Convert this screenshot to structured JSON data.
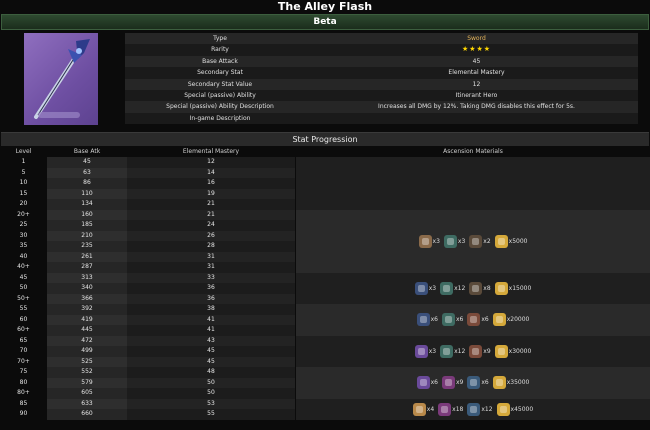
{
  "page": {
    "title": "The Alley Flash",
    "section": "Beta"
  },
  "info": [
    {
      "key": "Type",
      "value": "Sword",
      "cls": "type"
    },
    {
      "key": "Rarity",
      "value": "★★★★",
      "cls": "stars"
    },
    {
      "key": "Base Attack",
      "value": "45",
      "cls": ""
    },
    {
      "key": "Secondary Stat",
      "value": "Elemental Mastery",
      "cls": ""
    },
    {
      "key": "Secondary Stat Value",
      "value": "12",
      "cls": ""
    },
    {
      "key": "Special (passive) Ability",
      "value": "Itinerant Hero",
      "cls": ""
    },
    {
      "key": "Special (passive) Ability Description",
      "value": "Increases all DMG by 12%. Taking DMG disables this effect for 5s.",
      "cls": ""
    },
    {
      "key": "In-game Description",
      "value": "",
      "cls": ""
    }
  ],
  "progression": {
    "title": "Stat Progression",
    "headers": {
      "level": "Level",
      "atk": "Base Atk",
      "em": "Elemental Mastery",
      "asc": "Ascension Materials"
    },
    "rows": [
      {
        "lv": "1",
        "atk": "45",
        "em": "12"
      },
      {
        "lv": "5",
        "atk": "63",
        "em": "14"
      },
      {
        "lv": "10",
        "atk": "86",
        "em": "16"
      },
      {
        "lv": "15",
        "atk": "110",
        "em": "19"
      },
      {
        "lv": "20",
        "atk": "134",
        "em": "21"
      },
      {
        "lv": "20+",
        "atk": "160",
        "em": "21"
      },
      {
        "lv": "25",
        "atk": "185",
        "em": "24"
      },
      {
        "lv": "30",
        "atk": "210",
        "em": "26"
      },
      {
        "lv": "35",
        "atk": "235",
        "em": "28"
      },
      {
        "lv": "40",
        "atk": "261",
        "em": "31"
      },
      {
        "lv": "40+",
        "atk": "287",
        "em": "31"
      },
      {
        "lv": "45",
        "atk": "313",
        "em": "33"
      },
      {
        "lv": "50",
        "atk": "340",
        "em": "36"
      },
      {
        "lv": "50+",
        "atk": "366",
        "em": "36"
      },
      {
        "lv": "55",
        "atk": "392",
        "em": "38"
      },
      {
        "lv": "60",
        "atk": "419",
        "em": "41"
      },
      {
        "lv": "60+",
        "atk": "445",
        "em": "41"
      },
      {
        "lv": "65",
        "atk": "472",
        "em": "43"
      },
      {
        "lv": "70",
        "atk": "499",
        "em": "45"
      },
      {
        "lv": "70+",
        "atk": "525",
        "em": "45"
      },
      {
        "lv": "75",
        "atk": "552",
        "em": "48"
      },
      {
        "lv": "80",
        "atk": "579",
        "em": "50"
      },
      {
        "lv": "80+",
        "atk": "605",
        "em": "50"
      },
      {
        "lv": "85",
        "atk": "633",
        "em": "53"
      },
      {
        "lv": "90",
        "atk": "660",
        "em": "55"
      }
    ],
    "ascensions": [
      {
        "mats": [
          {
            "icon": "domain-material-icon",
            "color": "#8a6a4a",
            "qty": "x3"
          },
          {
            "icon": "enemy-drop-icon",
            "color": "#3e6b62",
            "qty": "x3"
          },
          {
            "icon": "common-drop-icon",
            "color": "#5a4a3a",
            "qty": "x2"
          },
          {
            "icon": "mora-icon",
            "color": "#d4a83a",
            "qty": "x5000"
          }
        ]
      },
      {
        "mats": [
          {
            "icon": "domain-material-icon",
            "color": "#3a4f7a",
            "qty": "x3"
          },
          {
            "icon": "enemy-drop-icon",
            "color": "#3e6b62",
            "qty": "x12"
          },
          {
            "icon": "common-drop-icon",
            "color": "#5a4a3a",
            "qty": "x8"
          },
          {
            "icon": "mora-icon",
            "color": "#d4a83a",
            "qty": "x15000"
          }
        ]
      },
      {
        "mats": [
          {
            "icon": "domain-material-icon",
            "color": "#3a4f7a",
            "qty": "x6"
          },
          {
            "icon": "enemy-drop-icon",
            "color": "#3e6b62",
            "qty": "x6"
          },
          {
            "icon": "common-drop-icon",
            "color": "#7a4a3a",
            "qty": "x6"
          },
          {
            "icon": "mora-icon",
            "color": "#d4a83a",
            "qty": "x20000"
          }
        ]
      },
      {
        "mats": [
          {
            "icon": "domain-material-icon",
            "color": "#6a4a9a",
            "qty": "x3"
          },
          {
            "icon": "enemy-drop-icon",
            "color": "#3e6b62",
            "qty": "x12"
          },
          {
            "icon": "common-drop-icon",
            "color": "#7a4a3a",
            "qty": "x9"
          },
          {
            "icon": "mora-icon",
            "color": "#d4a83a",
            "qty": "x30000"
          }
        ]
      },
      {
        "mats": [
          {
            "icon": "domain-material-icon",
            "color": "#6a4a9a",
            "qty": "x6"
          },
          {
            "icon": "enemy-drop-icon",
            "color": "#7a3a7a",
            "qty": "x9"
          },
          {
            "icon": "common-drop-icon",
            "color": "#3a5a7a",
            "qty": "x6"
          },
          {
            "icon": "mora-icon",
            "color": "#d4a83a",
            "qty": "x35000"
          }
        ]
      },
      {
        "mats": [
          {
            "icon": "domain-material-icon",
            "color": "#b8894a",
            "qty": "x4"
          },
          {
            "icon": "enemy-drop-icon",
            "color": "#7a3a7a",
            "qty": "x18"
          },
          {
            "icon": "common-drop-icon",
            "color": "#3a5a7a",
            "qty": "x12"
          },
          {
            "icon": "mora-icon",
            "color": "#d4a83a",
            "qty": "x45000"
          }
        ]
      }
    ]
  }
}
